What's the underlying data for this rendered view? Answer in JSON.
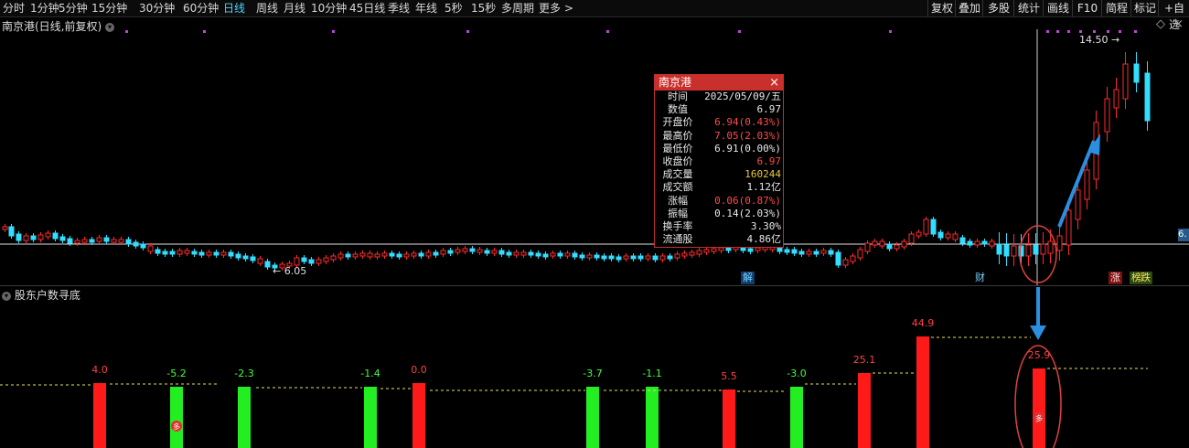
{
  "toolbar": {
    "left": [
      "分时",
      "1分钟",
      "5分钟",
      "15分钟",
      "30分钟",
      "60分钟",
      "日线",
      "周线",
      "月线",
      "10分钟",
      "45日线",
      "季线",
      "年线",
      "5秒",
      "15秒",
      "多周期",
      "更多 >"
    ],
    "active": "日线",
    "right": [
      "复权",
      "叠加",
      "多股",
      "统计",
      "画线",
      "F10",
      "简程",
      "标记",
      "+自选"
    ]
  },
  "main_title": "南京港(日线,前复权)",
  "price_labels": {
    "high": "14.50",
    "low": "6.05",
    "right_edge": "6."
  },
  "event_tags": {
    "jie": "解",
    "cai": "财",
    "zhang": "涨",
    "bang": "榜",
    "die": "跌"
  },
  "popup": {
    "title": "南京港",
    "close": "×",
    "rows": [
      {
        "label": "时间",
        "value": "2025/05/09/五",
        "color": "#e8e8e8"
      },
      {
        "label": "数值",
        "value": "6.97",
        "color": "#e8e8e8"
      },
      {
        "label": "开盘价",
        "value": "6.94(0.43%)",
        "color": "#ff4a4a"
      },
      {
        "label": "最高价",
        "value": "7.05(2.03%)",
        "color": "#ff4a4a"
      },
      {
        "label": "最低价",
        "value": "6.91(0.00%)",
        "color": "#e8e8e8"
      },
      {
        "label": "收盘价",
        "value": "6.97",
        "color": "#ff4a4a"
      },
      {
        "label": "成交量",
        "value": "160244",
        "color": "#e8c840"
      },
      {
        "label": "成交额",
        "value": "1.12亿",
        "color": "#e8e8e8"
      },
      {
        "label": "涨幅",
        "value": "0.06(0.87%)",
        "color": "#ff4a4a"
      },
      {
        "label": "振幅",
        "value": "0.14(2.03%)",
        "color": "#e8e8e8"
      },
      {
        "label": "换手率",
        "value": "3.30%",
        "color": "#e8e8e8"
      },
      {
        "label": "流通股",
        "value": "4.86亿",
        "color": "#e8e8e8"
      }
    ]
  },
  "indicator": {
    "title": "股东户数寻底",
    "bars": [
      {
        "label": "4.0",
        "value": 4.0
      },
      {
        "label": "-5.2",
        "value": -5.2
      },
      {
        "label": "-2.3",
        "value": -2.3
      },
      {
        "label": "-1.4",
        "value": -1.4
      },
      {
        "label": "0.0",
        "value": 0.0
      },
      {
        "label": "-3.7",
        "value": -3.7
      },
      {
        "label": "-1.1",
        "value": -1.1
      },
      {
        "label": "5.5",
        "value": 5.5
      },
      {
        "label": "-3.0",
        "value": -3.0
      },
      {
        "label": "25.1",
        "value": 25.1
      },
      {
        "label": "44.9",
        "value": 44.9
      },
      {
        "label": "25.9",
        "value": 25.9
      }
    ],
    "markers": [
      "多",
      "多"
    ]
  },
  "colors": {
    "up": "#ff2a2a",
    "down": "#33ddff",
    "green_bar": "#22ee22",
    "red_bar": "#ff1a1a",
    "accent": "#4fd3ff"
  }
}
